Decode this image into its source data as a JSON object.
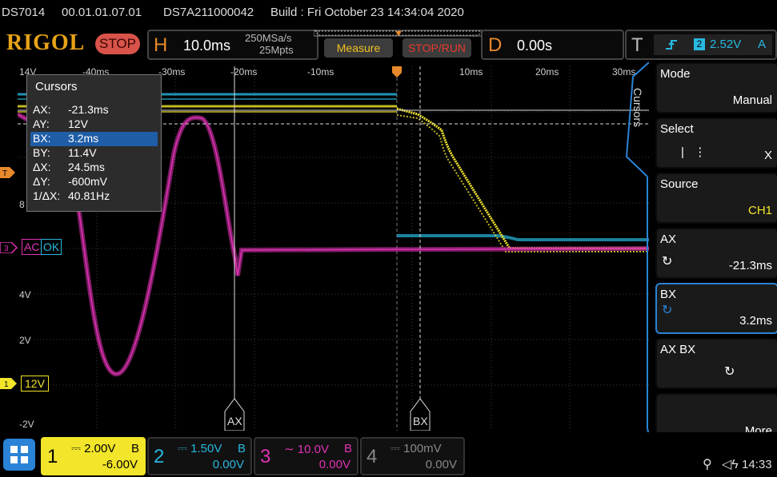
{
  "infobar": {
    "model": "DS7014",
    "firmware": "00.01.01.07.01",
    "serial": "DS7A211000042",
    "build": "Build : Fri October 23 14:34:04 2020"
  },
  "header": {
    "logo": "RIGOL",
    "run_state": "STOP",
    "h_letter": "H",
    "timebase": "10.0ms",
    "sample_rate": "250MSa/s",
    "memory_depth": "25Mpts",
    "measure_label": "Measure",
    "stoprun_label": "STOP/RUN",
    "d_letter": "D",
    "delay": "0.00s",
    "t_letter": "T",
    "trigger_channel": "2",
    "trigger_level": "2.52V",
    "trigger_mode": "A",
    "colors": {
      "accent": "#e8892b",
      "stop": "#d8534a",
      "trigger": "#28b8e0"
    }
  },
  "grid": {
    "time_labels": [
      "-40ms",
      "-30ms",
      "-20ms",
      "-10ms",
      "10ms",
      "20ms",
      "30ms"
    ],
    "volt_labels": [
      "14V",
      "8",
      "4V",
      "2V",
      "-2V"
    ],
    "ch1_offset_label": "12V",
    "ch3_marker_ac": "AC",
    "ch3_marker_ok": "OK",
    "cursor_a_label": "AX",
    "cursor_b_label": "BX"
  },
  "cursors": {
    "title": "Cursors",
    "rows": [
      {
        "key": "AX:",
        "value": "-21.3ms"
      },
      {
        "key": "AY:",
        "value": "12V"
      },
      {
        "key": "BX:",
        "value": "3.2ms"
      },
      {
        "key": "BY:",
        "value": "11.4V"
      },
      {
        "key": "ΔX:",
        "value": "24.5ms"
      },
      {
        "key": "ΔY:",
        "value": "-600mV"
      },
      {
        "key": "1/ΔX:",
        "value": "40.81Hz"
      }
    ],
    "selected_row": 2
  },
  "menu": {
    "side_tab": "Cursors",
    "items": [
      {
        "label": "Mode",
        "value": "Manual"
      },
      {
        "label": "Select",
        "value": "X"
      },
      {
        "label": "Source",
        "value": "CH1"
      },
      {
        "label": "AX",
        "value": "-21.3ms"
      },
      {
        "label": "BX",
        "value": "3.2ms"
      },
      {
        "label": "AX BX",
        "value": ""
      },
      {
        "label": "",
        "value": "More"
      }
    ]
  },
  "channels": [
    {
      "num": "1",
      "scale": "2.00V",
      "offset": "-6.00V",
      "bw": "B",
      "color": "#f2e52a"
    },
    {
      "num": "2",
      "scale": "1.50V",
      "offset": "0.00V",
      "bw": "B",
      "color": "#28b8e0"
    },
    {
      "num": "3",
      "scale": "10.0V",
      "offset": "0.00V",
      "bw": "B",
      "color": "#e032b4"
    },
    {
      "num": "4",
      "scale": "100mV",
      "offset": "0.00V",
      "bw": "",
      "color": "#888888"
    }
  ],
  "status": {
    "time": "14:33"
  }
}
